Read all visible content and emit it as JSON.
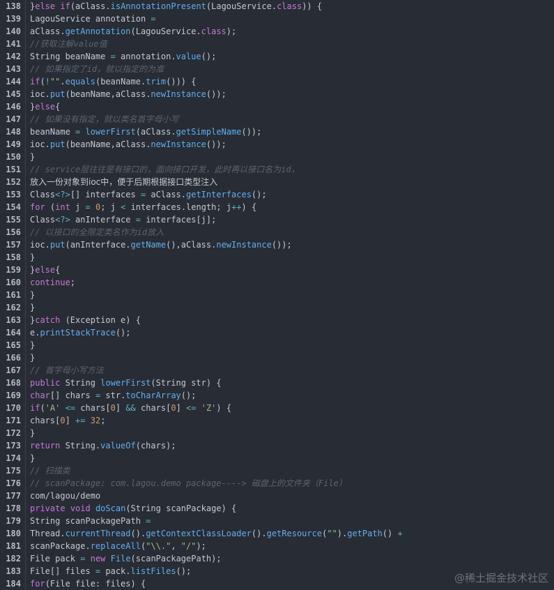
{
  "lines": [
    {
      "n": "138",
      "tokens": [
        [
          "tx",
          "}"
        ],
        [
          "kw",
          "else"
        ],
        [
          "tx",
          " "
        ],
        [
          "kw",
          "if"
        ],
        [
          "tx",
          "(aClass."
        ],
        [
          "fn",
          "isAnnotationPresent"
        ],
        [
          "tx",
          "(LagouService."
        ],
        [
          "kw",
          "class"
        ],
        [
          "tx",
          ")) {"
        ]
      ]
    },
    {
      "n": "139",
      "tokens": [
        [
          "tx",
          "LagouService annotation "
        ],
        [
          "op",
          "="
        ]
      ]
    },
    {
      "n": "140",
      "tokens": [
        [
          "tx",
          "aClass."
        ],
        [
          "fn",
          "getAnnotation"
        ],
        [
          "tx",
          "(LagouService."
        ],
        [
          "kw",
          "class"
        ],
        [
          "tx",
          ");"
        ]
      ]
    },
    {
      "n": "141",
      "tokens": [
        [
          "cm",
          "//获取注解value值"
        ]
      ]
    },
    {
      "n": "142",
      "tokens": [
        [
          "tx",
          "String beanName "
        ],
        [
          "op",
          "="
        ],
        [
          "tx",
          " annotation."
        ],
        [
          "fn",
          "value"
        ],
        [
          "tx",
          "();"
        ]
      ]
    },
    {
      "n": "143",
      "tokens": [
        [
          "cm",
          "// 如果指定了id，就以指定的为准"
        ]
      ]
    },
    {
      "n": "144",
      "tokens": [
        [
          "kw",
          "if"
        ],
        [
          "tx",
          "("
        ],
        [
          "op",
          "!"
        ],
        [
          "str",
          "\"\""
        ],
        [
          "tx",
          "."
        ],
        [
          "fn",
          "equals"
        ],
        [
          "tx",
          "(beanName."
        ],
        [
          "fn",
          "trim"
        ],
        [
          "tx",
          "())) {"
        ]
      ]
    },
    {
      "n": "145",
      "tokens": [
        [
          "tx",
          "ioc."
        ],
        [
          "fn",
          "put"
        ],
        [
          "tx",
          "(beanName,aClass."
        ],
        [
          "fn",
          "newInstance"
        ],
        [
          "tx",
          "());"
        ]
      ]
    },
    {
      "n": "146",
      "tokens": [
        [
          "tx",
          "}"
        ],
        [
          "kw",
          "else"
        ],
        [
          "tx",
          "{"
        ]
      ]
    },
    {
      "n": "147",
      "tokens": [
        [
          "cm",
          "// 如果没有指定，就以类名首字母小写"
        ]
      ]
    },
    {
      "n": "148",
      "tokens": [
        [
          "tx",
          "beanName "
        ],
        [
          "op",
          "="
        ],
        [
          "tx",
          " "
        ],
        [
          "fn",
          "lowerFirst"
        ],
        [
          "tx",
          "(aClass."
        ],
        [
          "fn",
          "getSimpleName"
        ],
        [
          "tx",
          "());"
        ]
      ]
    },
    {
      "n": "149",
      "tokens": [
        [
          "tx",
          "ioc."
        ],
        [
          "fn",
          "put"
        ],
        [
          "tx",
          "(beanName,aClass."
        ],
        [
          "fn",
          "newInstance"
        ],
        [
          "tx",
          "());"
        ]
      ]
    },
    {
      "n": "150",
      "tokens": [
        [
          "tx",
          "}"
        ]
      ]
    },
    {
      "n": "151",
      "tokens": [
        [
          "cm",
          "// service层往往是有接口的，面向接口开发，此时再以接口名为id，"
        ]
      ]
    },
    {
      "n": "152",
      "cjk": true,
      "tokens": [
        [
          "tx",
          "放入一份对象到ioc中，便于后期根据接口类型注入"
        ]
      ]
    },
    {
      "n": "153",
      "tokens": [
        [
          "tx",
          "Class"
        ],
        [
          "op",
          "<?>"
        ],
        [
          "tx",
          "[] interfaces "
        ],
        [
          "op",
          "="
        ],
        [
          "tx",
          " aClass."
        ],
        [
          "fn",
          "getInterfaces"
        ],
        [
          "tx",
          "();"
        ]
      ]
    },
    {
      "n": "154",
      "tokens": [
        [
          "kw",
          "for"
        ],
        [
          "tx",
          " ("
        ],
        [
          "kw",
          "int"
        ],
        [
          "tx",
          " j "
        ],
        [
          "op",
          "="
        ],
        [
          "tx",
          " "
        ],
        [
          "num",
          "0"
        ],
        [
          "tx",
          "; j "
        ],
        [
          "op",
          "<"
        ],
        [
          "tx",
          " interfaces.length; j"
        ],
        [
          "op",
          "++"
        ],
        [
          "tx",
          ") {"
        ]
      ]
    },
    {
      "n": "155",
      "tokens": [
        [
          "tx",
          "Class"
        ],
        [
          "op",
          "<?>"
        ],
        [
          "tx",
          " anInterface "
        ],
        [
          "op",
          "="
        ],
        [
          "tx",
          " interfaces[j];"
        ]
      ]
    },
    {
      "n": "156",
      "tokens": [
        [
          "cm",
          "// 以接口的全限定类名作为id放入"
        ]
      ]
    },
    {
      "n": "157",
      "tokens": [
        [
          "tx",
          "ioc."
        ],
        [
          "fn",
          "put"
        ],
        [
          "tx",
          "(anInterface."
        ],
        [
          "fn",
          "getName"
        ],
        [
          "tx",
          "(),aClass."
        ],
        [
          "fn",
          "newInstance"
        ],
        [
          "tx",
          "());"
        ]
      ]
    },
    {
      "n": "158",
      "tokens": [
        [
          "tx",
          "}"
        ]
      ]
    },
    {
      "n": "159",
      "tokens": [
        [
          "tx",
          "}"
        ],
        [
          "kw",
          "else"
        ],
        [
          "tx",
          "{"
        ]
      ]
    },
    {
      "n": "160",
      "tokens": [
        [
          "kw",
          "continue"
        ],
        [
          "tx",
          ";"
        ]
      ]
    },
    {
      "n": "161",
      "tokens": [
        [
          "tx",
          "}"
        ]
      ]
    },
    {
      "n": "162",
      "tokens": [
        [
          "tx",
          "}"
        ]
      ]
    },
    {
      "n": "163",
      "tokens": [
        [
          "tx",
          "}"
        ],
        [
          "kw",
          "catch"
        ],
        [
          "tx",
          " (Exception e) {"
        ]
      ]
    },
    {
      "n": "164",
      "tokens": [
        [
          "tx",
          "e."
        ],
        [
          "fn",
          "printStackTrace"
        ],
        [
          "tx",
          "();"
        ]
      ]
    },
    {
      "n": "165",
      "tokens": [
        [
          "tx",
          "}"
        ]
      ]
    },
    {
      "n": "166",
      "tokens": [
        [
          "tx",
          "}"
        ]
      ]
    },
    {
      "n": "167",
      "tokens": [
        [
          "cm",
          "// 首字母小写方法"
        ]
      ]
    },
    {
      "n": "168",
      "tokens": [
        [
          "kw",
          "public"
        ],
        [
          "tx",
          " String "
        ],
        [
          "fn",
          "lowerFirst"
        ],
        [
          "tx",
          "(String str) {"
        ]
      ]
    },
    {
      "n": "169",
      "tokens": [
        [
          "kw",
          "char"
        ],
        [
          "tx",
          "[] chars "
        ],
        [
          "op",
          "="
        ],
        [
          "tx",
          " str."
        ],
        [
          "fn",
          "toCharArray"
        ],
        [
          "tx",
          "();"
        ]
      ]
    },
    {
      "n": "170",
      "tokens": [
        [
          "kw",
          "if"
        ],
        [
          "tx",
          "("
        ],
        [
          "str",
          "'A'"
        ],
        [
          "tx",
          " "
        ],
        [
          "op",
          "<="
        ],
        [
          "tx",
          " chars["
        ],
        [
          "num",
          "0"
        ],
        [
          "tx",
          "] "
        ],
        [
          "op",
          "&&"
        ],
        [
          "tx",
          " chars["
        ],
        [
          "num",
          "0"
        ],
        [
          "tx",
          "] "
        ],
        [
          "op",
          "<="
        ],
        [
          "tx",
          " "
        ],
        [
          "str",
          "'Z'"
        ],
        [
          "tx",
          ") {"
        ]
      ]
    },
    {
      "n": "171",
      "tokens": [
        [
          "tx",
          "chars["
        ],
        [
          "num",
          "0"
        ],
        [
          "tx",
          "] "
        ],
        [
          "op",
          "+="
        ],
        [
          "tx",
          " "
        ],
        [
          "num",
          "32"
        ],
        [
          "tx",
          ";"
        ]
      ]
    },
    {
      "n": "172",
      "tokens": [
        [
          "tx",
          "}"
        ]
      ]
    },
    {
      "n": "173",
      "tokens": [
        [
          "kw",
          "return"
        ],
        [
          "tx",
          " String."
        ],
        [
          "fn",
          "valueOf"
        ],
        [
          "tx",
          "(chars);"
        ]
      ]
    },
    {
      "n": "174",
      "tokens": [
        [
          "tx",
          "}"
        ]
      ]
    },
    {
      "n": "175",
      "tokens": [
        [
          "cm",
          "// 扫描类"
        ]
      ]
    },
    {
      "n": "176",
      "tokens": [
        [
          "cm",
          "// scanPackage: com.lagou.demo package----> 磁盘上的文件夹（File）"
        ]
      ]
    },
    {
      "n": "177",
      "tokens": [
        [
          "tx",
          "com/lagou/demo"
        ]
      ]
    },
    {
      "n": "178",
      "tokens": [
        [
          "kw",
          "private"
        ],
        [
          "tx",
          " "
        ],
        [
          "kw",
          "void"
        ],
        [
          "tx",
          " "
        ],
        [
          "fn",
          "doScan"
        ],
        [
          "tx",
          "(String scanPackage) {"
        ]
      ]
    },
    {
      "n": "179",
      "tokens": [
        [
          "tx",
          "String scanPackagePath "
        ],
        [
          "op",
          "="
        ]
      ]
    },
    {
      "n": "180",
      "tokens": [
        [
          "tx",
          "Thread."
        ],
        [
          "fn",
          "currentThread"
        ],
        [
          "tx",
          "()."
        ],
        [
          "fn",
          "getContextClassLoader"
        ],
        [
          "tx",
          "()."
        ],
        [
          "fn",
          "getResource"
        ],
        [
          "tx",
          "("
        ],
        [
          "str",
          "\"\""
        ],
        [
          "tx",
          ")."
        ],
        [
          "fn",
          "getPath"
        ],
        [
          "tx",
          "() "
        ],
        [
          "op",
          "+"
        ]
      ]
    },
    {
      "n": "181",
      "tokens": [
        [
          "tx",
          "scanPackage."
        ],
        [
          "fn",
          "replaceAll"
        ],
        [
          "tx",
          "("
        ],
        [
          "str",
          "\"\\\\.\""
        ],
        [
          "tx",
          ", "
        ],
        [
          "str",
          "\"/\""
        ],
        [
          "tx",
          ");"
        ]
      ]
    },
    {
      "n": "182",
      "tokens": [
        [
          "tx",
          "File pack "
        ],
        [
          "op",
          "="
        ],
        [
          "tx",
          " "
        ],
        [
          "kw",
          "new"
        ],
        [
          "tx",
          " "
        ],
        [
          "fn",
          "File"
        ],
        [
          "tx",
          "(scanPackagePath);"
        ]
      ]
    },
    {
      "n": "183",
      "tokens": [
        [
          "tx",
          "File[] files "
        ],
        [
          "op",
          "="
        ],
        [
          "tx",
          " pack."
        ],
        [
          "fn",
          "listFiles"
        ],
        [
          "tx",
          "();"
        ]
      ]
    },
    {
      "n": "184",
      "tokens": [
        [
          "kw",
          "for"
        ],
        [
          "tx",
          "(File file: files) {"
        ]
      ]
    }
  ],
  "watermark": "@稀土掘金技术社区"
}
